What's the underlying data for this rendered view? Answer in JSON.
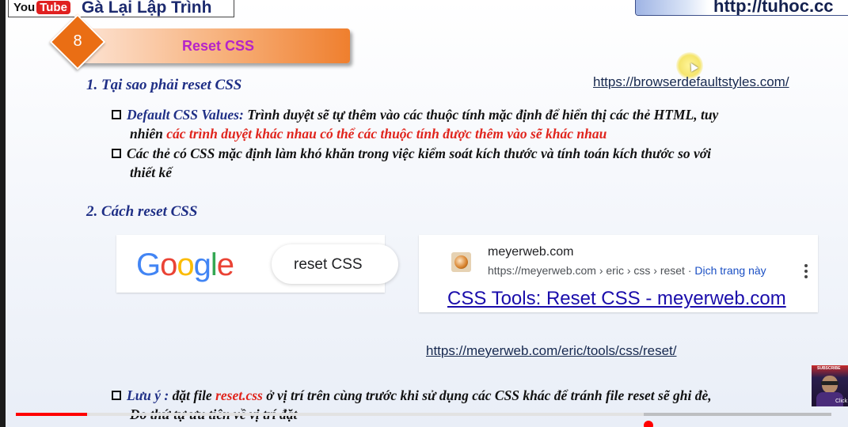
{
  "header": {
    "youtube_logo_you": "You",
    "youtube_logo_tube": "Tube",
    "channel_name": "Gà Lại Lập Trình",
    "website_url": "http://tuhoc.cc"
  },
  "slide": {
    "number": "8",
    "title": "Reset CSS",
    "section1": {
      "heading": "1.  Tại sao phải reset CSS",
      "reference_link": "https://browserdefaultstyles.com/",
      "bullet1_label": "Default CSS Values:",
      "bullet1_text": " Trình duyệt sẽ tự thêm vào các thuộc tính mặc định để hiển thị các thẻ HTML, tuy",
      "bullet1_line2_plain": "nhiên ",
      "bullet1_line2_red": "các trình duyệt khác nhau có thể các thuộc tính được thêm vào sẽ khác nhau",
      "bullet2_line1": "Các thẻ có CSS mặc định làm khó khăn trong việc kiểm soát kích thước và tính toán kích thước so với",
      "bullet2_line2": "thiết kế"
    },
    "section2": {
      "heading": "2.   Cách reset CSS",
      "google_search": {
        "logo_letters": [
          "G",
          "o",
          "o",
          "g",
          "l",
          "e"
        ],
        "query": "reset CSS"
      },
      "search_result": {
        "site_name": "meyerweb.com",
        "breadcrumb": "https://meyerweb.com › eric › css › reset · ",
        "translate_label": "Dịch trang này",
        "title": "CSS Tools: Reset CSS - meyerweb.com"
      },
      "reset_link": "https://meyerweb.com/eric/tools/css/reset/",
      "note_label": "Lưu ý :",
      "note_text_before": " đặt file ",
      "note_file": "reset.css",
      "note_text_after": " ở vị trí trên cùng trước khi sử dụng các CSS khác để tránh file reset sẽ ghi đè,",
      "note_line2": "Do thứ tự ưu tiên về vị trí đặt"
    }
  },
  "overlay": {
    "subscribe_label": "SUBSCRIBE",
    "click_label": "Click",
    "progress_fraction": 0.087,
    "buffered_fraction": 0.77
  },
  "colors": {
    "title_text": "#b524c9",
    "number_badge": "#ea6e14",
    "heading_blue": "#1f2f86",
    "highlight_red": "#e0241c",
    "progress_red": "#ff0000"
  }
}
